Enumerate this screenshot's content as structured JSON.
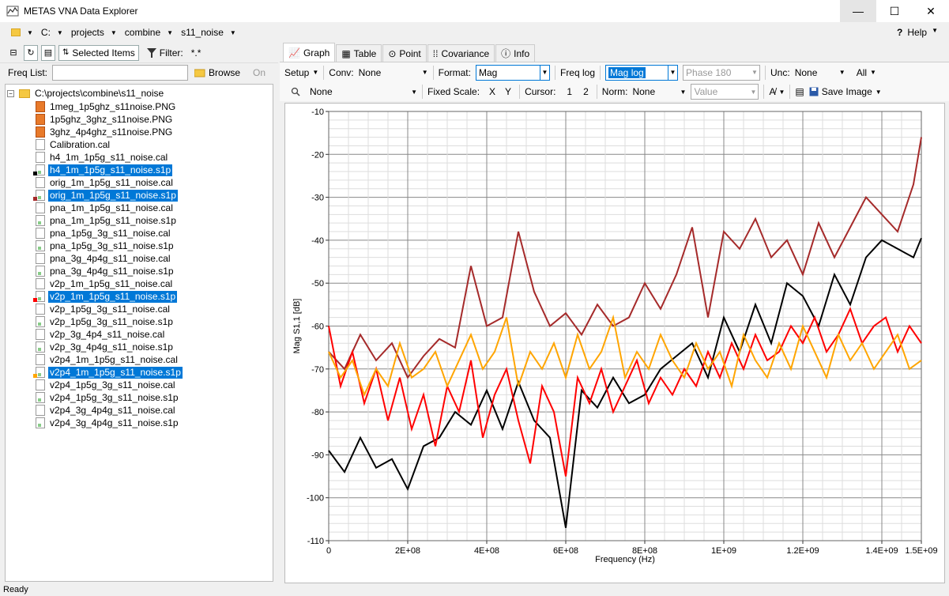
{
  "window": {
    "title": "METAS VNA Data Explorer",
    "minimize": "—",
    "maximize": "☐",
    "close": "✕"
  },
  "address": {
    "crumbs": [
      "C:",
      "projects",
      "combine",
      "s11_noise"
    ],
    "help": "Help",
    "help_icon": "?"
  },
  "left_toolbar": {
    "selected_items": "Selected Items",
    "filter_label": "Filter:",
    "filter_value": "*.*"
  },
  "freq_list": {
    "label": "Freq List:",
    "browse": "Browse",
    "on": "On"
  },
  "tree": {
    "root": "C:\\projects\\combine\\s11_noise",
    "items": [
      {
        "name": "1meg_1p5ghz_s11noise.PNG",
        "type": "png",
        "selected": false
      },
      {
        "name": "1p5ghz_3ghz_s11noise.PNG",
        "type": "png",
        "selected": false
      },
      {
        "name": "3ghz_4p4ghz_s11noise.PNG",
        "type": "png",
        "selected": false
      },
      {
        "name": "Calibration.cal",
        "type": "cal",
        "selected": false
      },
      {
        "name": "h4_1m_1p5g_s11_noise.cal",
        "type": "cal",
        "selected": false
      },
      {
        "name": "h4_1m_1p5g_s11_noise.s1p",
        "type": "s1p",
        "selected": true,
        "color": "#000000"
      },
      {
        "name": "orig_1m_1p5g_s11_noise.cal",
        "type": "cal",
        "selected": false
      },
      {
        "name": "orig_1m_1p5g_s11_noise.s1p",
        "type": "s1p",
        "selected": true,
        "color": "#a52a2a"
      },
      {
        "name": "pna_1m_1p5g_s11_noise.cal",
        "type": "cal",
        "selected": false
      },
      {
        "name": "pna_1m_1p5g_s11_noise.s1p",
        "type": "s1p",
        "selected": false
      },
      {
        "name": "pna_1p5g_3g_s11_noise.cal",
        "type": "cal",
        "selected": false
      },
      {
        "name": "pna_1p5g_3g_s11_noise.s1p",
        "type": "s1p",
        "selected": false
      },
      {
        "name": "pna_3g_4p4g_s11_noise.cal",
        "type": "cal",
        "selected": false
      },
      {
        "name": "pna_3g_4p4g_s11_noise.s1p",
        "type": "s1p",
        "selected": false
      },
      {
        "name": "v2p_1m_1p5g_s11_noise.cal",
        "type": "cal",
        "selected": false
      },
      {
        "name": "v2p_1m_1p5g_s11_noise.s1p",
        "type": "s1p",
        "selected": true,
        "color": "#ff0000"
      },
      {
        "name": "v2p_1p5g_3g_s11_noise.cal",
        "type": "cal",
        "selected": false
      },
      {
        "name": "v2p_1p5g_3g_s11_noise.s1p",
        "type": "s1p",
        "selected": false
      },
      {
        "name": "v2p_3g_4p4_s11_noise.cal",
        "type": "cal",
        "selected": false
      },
      {
        "name": "v2p_3g_4p4g_s11_noise.s1p",
        "type": "s1p",
        "selected": false
      },
      {
        "name": "v2p4_1m_1p5g_s11_noise.cal",
        "type": "cal",
        "selected": false
      },
      {
        "name": "v2p4_1m_1p5g_s11_noise.s1p",
        "type": "s1p",
        "selected": true,
        "color": "#ffa500"
      },
      {
        "name": "v2p4_1p5g_3g_s11_noise.cal",
        "type": "cal",
        "selected": false
      },
      {
        "name": "v2p4_1p5g_3g_s11_noise.s1p",
        "type": "s1p",
        "selected": false
      },
      {
        "name": "v2p4_3g_4p4g_s11_noise.cal",
        "type": "cal",
        "selected": false
      },
      {
        "name": "v2p4_3g_4p4g_s11_noise.s1p",
        "type": "s1p",
        "selected": false
      }
    ]
  },
  "tabs": [
    "Graph",
    "Table",
    "Point",
    "Covariance",
    "Info"
  ],
  "toolbar1": {
    "setup": "Setup",
    "conv_label": "Conv:",
    "conv_value": "None",
    "format_label": "Format:",
    "format_value": "Mag",
    "freq_log": "Freq log",
    "mag_log": "Mag log",
    "phase": "Phase 180",
    "unc_label": "Unc:",
    "unc_value": "None",
    "all": "All"
  },
  "toolbar2": {
    "zoom_value": "None",
    "fixed_scale": "Fixed Scale:",
    "x": "X",
    "y": "Y",
    "cursor": "Cursor:",
    "c1": "1",
    "c2": "2",
    "norm_label": "Norm:",
    "norm_value": "None",
    "value_placeholder": "Value",
    "save_image": "Save Image"
  },
  "status": {
    "text": "Ready"
  },
  "chart_data": {
    "type": "line",
    "xlabel": "Frequency (Hz)",
    "ylabel": "Mag S1,1 [dB]",
    "xlim": [
      0,
      1500000000
    ],
    "ylim": [
      -110,
      -10
    ],
    "xticks": [
      0,
      200000000,
      400000000,
      600000000,
      800000000,
      1000000000,
      1200000000,
      1400000000,
      1500000000
    ],
    "xtick_labels": [
      "0",
      "2E+08",
      "4E+08",
      "6E+08",
      "8E+08",
      "1E+09",
      "1.2E+09",
      "1.4E+09",
      "1.5E+09"
    ],
    "yticks": [
      -10,
      -20,
      -30,
      -40,
      -50,
      -60,
      -70,
      -80,
      -90,
      -100,
      -110
    ],
    "ytick_labels": [
      "-10",
      "-20",
      "-30",
      "-40",
      "-50",
      "-60",
      "-70",
      "-80",
      "-90",
      "-100",
      "-110"
    ],
    "grid": true,
    "series": [
      {
        "color": "#000000",
        "x": [
          0,
          40000000,
          80000000,
          120000000,
          160000000,
          200000000,
          240000000,
          280000000,
          320000000,
          360000000,
          400000000,
          440000000,
          480000000,
          520000000,
          560000000,
          600000000,
          640000000,
          680000000,
          720000000,
          760000000,
          800000000,
          840000000,
          880000000,
          920000000,
          960000000,
          1000000000,
          1040000000,
          1080000000,
          1120000000,
          1160000000,
          1200000000,
          1240000000,
          1280000000,
          1320000000,
          1360000000,
          1400000000,
          1440000000,
          1480000000,
          1500000000
        ],
        "y": [
          -89,
          -94,
          -86,
          -93,
          -91,
          -98,
          -88,
          -86,
          -80,
          -83,
          -75,
          -84,
          -73,
          -82,
          -86,
          -107,
          -75,
          -79,
          -72,
          -78,
          -76,
          -70,
          -67,
          -64,
          -72,
          -58,
          -66,
          -55,
          -64,
          -50,
          -53,
          -60,
          -48,
          -55,
          -44,
          -40,
          -42,
          -44,
          -39.5
        ]
      },
      {
        "color": "#a52a2a",
        "x": [
          0,
          40000000,
          80000000,
          120000000,
          160000000,
          200000000,
          240000000,
          280000000,
          320000000,
          360000000,
          400000000,
          440000000,
          480000000,
          520000000,
          560000000,
          600000000,
          640000000,
          680000000,
          720000000,
          760000000,
          800000000,
          840000000,
          880000000,
          920000000,
          960000000,
          1000000000,
          1040000000,
          1080000000,
          1120000000,
          1160000000,
          1200000000,
          1240000000,
          1280000000,
          1320000000,
          1360000000,
          1400000000,
          1440000000,
          1480000000,
          1500000000
        ],
        "y": [
          -66,
          -70,
          -62,
          -68,
          -64,
          -72,
          -67,
          -63,
          -65,
          -46,
          -60,
          -58,
          -38,
          -52,
          -60,
          -57,
          -62,
          -55,
          -60,
          -58,
          -50,
          -56,
          -48,
          -37,
          -58,
          -38,
          -42,
          -35,
          -44,
          -40,
          -48,
          -36,
          -44,
          -37,
          -30,
          -34,
          -38,
          -27,
          -16
        ]
      },
      {
        "color": "#ff0000",
        "x": [
          0,
          30000000,
          60000000,
          90000000,
          120000000,
          150000000,
          180000000,
          210000000,
          240000000,
          270000000,
          300000000,
          330000000,
          360000000,
          390000000,
          420000000,
          450000000,
          480000000,
          510000000,
          540000000,
          570000000,
          600000000,
          630000000,
          660000000,
          690000000,
          720000000,
          750000000,
          780000000,
          810000000,
          840000000,
          870000000,
          900000000,
          930000000,
          960000000,
          990000000,
          1020000000,
          1050000000,
          1080000000,
          1110000000,
          1140000000,
          1170000000,
          1200000000,
          1230000000,
          1260000000,
          1290000000,
          1320000000,
          1350000000,
          1380000000,
          1410000000,
          1440000000,
          1470000000,
          1500000000
        ],
        "y": [
          -60,
          -74,
          -66,
          -78,
          -70,
          -82,
          -72,
          -84,
          -76,
          -88,
          -74,
          -80,
          -68,
          -86,
          -76,
          -70,
          -82,
          -92,
          -74,
          -80,
          -95,
          -72,
          -78,
          -70,
          -80,
          -74,
          -68,
          -78,
          -72,
          -76,
          -70,
          -74,
          -66,
          -72,
          -64,
          -70,
          -62,
          -68,
          -66,
          -60,
          -64,
          -58,
          -66,
          -62,
          -56,
          -64,
          -60,
          -58,
          -66,
          -60,
          -64
        ]
      },
      {
        "color": "#ffa500",
        "x": [
          0,
          30000000,
          60000000,
          90000000,
          120000000,
          150000000,
          180000000,
          210000000,
          240000000,
          270000000,
          300000000,
          330000000,
          360000000,
          390000000,
          420000000,
          450000000,
          480000000,
          510000000,
          540000000,
          570000000,
          600000000,
          630000000,
          660000000,
          690000000,
          720000000,
          750000000,
          780000000,
          810000000,
          840000000,
          870000000,
          900000000,
          930000000,
          960000000,
          990000000,
          1020000000,
          1050000000,
          1080000000,
          1110000000,
          1140000000,
          1170000000,
          1200000000,
          1230000000,
          1260000000,
          1290000000,
          1320000000,
          1350000000,
          1380000000,
          1410000000,
          1440000000,
          1470000000,
          1500000000
        ],
        "y": [
          -66,
          -72,
          -68,
          -76,
          -70,
          -74,
          -64,
          -72,
          -70,
          -66,
          -74,
          -68,
          -62,
          -70,
          -66,
          -58,
          -74,
          -66,
          -70,
          -64,
          -72,
          -62,
          -70,
          -66,
          -58,
          -72,
          -66,
          -70,
          -62,
          -68,
          -72,
          -64,
          -70,
          -66,
          -74,
          -62,
          -68,
          -72,
          -64,
          -70,
          -60,
          -66,
          -72,
          -62,
          -68,
          -64,
          -70,
          -66,
          -62,
          -70,
          -68
        ]
      }
    ]
  }
}
